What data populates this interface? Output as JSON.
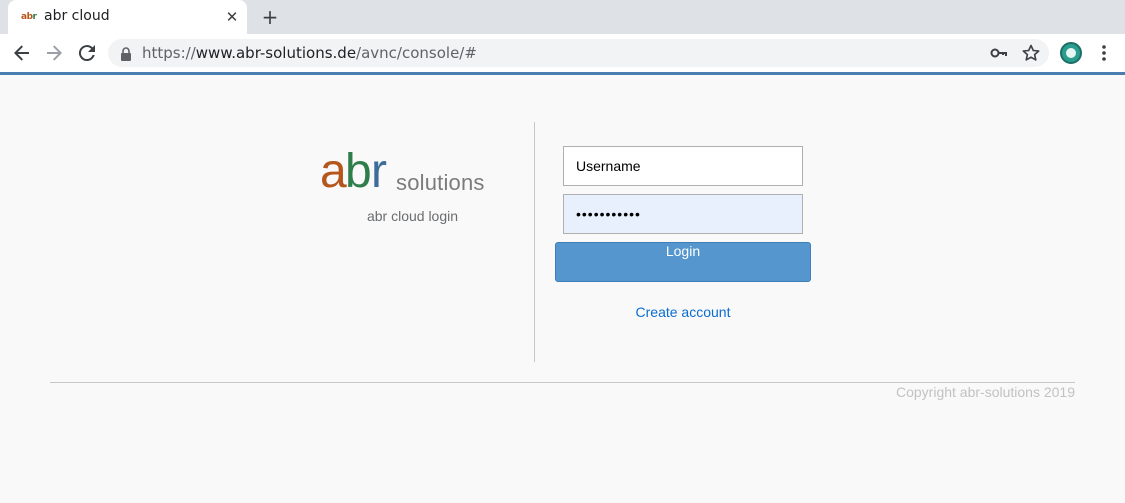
{
  "browser": {
    "tab": {
      "title": "abr cloud",
      "favicon_text_a": "ab",
      "favicon_text_b": "r",
      "close_glyph": "✕"
    },
    "new_tab_glyph": "+",
    "url": {
      "scheme": "https://",
      "host": "www.abr-solutions.de",
      "path": "/avnc/console/#"
    },
    "icons": [
      "back-icon",
      "forward-icon",
      "reload-icon",
      "lock-icon",
      "key-icon",
      "star-icon",
      "extension-icon",
      "menu-icon"
    ]
  },
  "page": {
    "logo": {
      "a": "a",
      "b": "b",
      "r": "r",
      "solutions": "solutions"
    },
    "subtitle": "abr cloud login",
    "form": {
      "username_value": "Username",
      "password_value": "•••••••••••",
      "login_label": "Login",
      "create_account_label": "Create account"
    },
    "footer": {
      "copyright": "Copyright abr-solutions 2019"
    }
  },
  "colors": {
    "accent_bar": "#4a7db0",
    "login_button": "#5496cd",
    "link": "#0a6ed1",
    "logo_a": "#b5561a",
    "logo_b": "#2e7d4a",
    "logo_r": "#3d6e98"
  }
}
